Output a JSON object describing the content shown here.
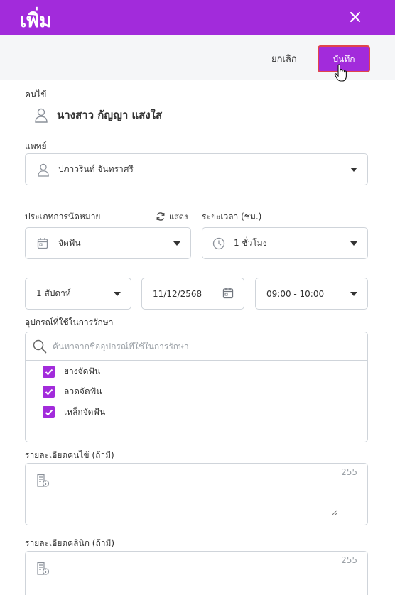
{
  "header": {
    "title": "เพิ่ม",
    "close_icon": "close-icon"
  },
  "toolbar": {
    "cancel_label": "ยกเลิก",
    "save_label": "บันทึก"
  },
  "patient": {
    "label": "คนไข้",
    "name": "นางสาว กัญญา แสงใส",
    "icon": "user-icon"
  },
  "doctor": {
    "label": "แพทย์",
    "value": "ปภาวรินท์ จันทราศรี",
    "icon": "user-icon"
  },
  "appointment_type": {
    "label": "ประเภทการนัดหมาย",
    "refresh_label": "แสดง",
    "value": "จัดฟัน",
    "icon": "calendar-icon"
  },
  "duration": {
    "label": "ระยะเวลา (ชม.)",
    "value": "1 ชั่วโมง",
    "icon": "clock-icon"
  },
  "schedule": {
    "period": "1 สัปดาห์",
    "date": "11/12/2568",
    "time": "09:00 - 10:00"
  },
  "equipment": {
    "label": "อุปกรณ์ที่ใช้ในการรักษา",
    "search_placeholder": "ค้นหาจากชื่ออุปกรณ์ที่ใช้ในการรักษา",
    "items": [
      {
        "label": "ยางจัดฟัน",
        "checked": true
      },
      {
        "label": "ลวดจัดฟัน",
        "checked": true
      },
      {
        "label": "เหล็กจัดฟัน",
        "checked": true
      }
    ]
  },
  "patient_detail": {
    "label": "รายละเอียดคนไข้ (ถ้ามี)",
    "counter": "255"
  },
  "clinic_detail": {
    "label": "รายละเอียดคลินิก (ถ้ามี)",
    "counter": "255"
  },
  "colors": {
    "primary": "#a22bdb",
    "border": "#cfd4da",
    "save_outline": "#e0454c"
  }
}
